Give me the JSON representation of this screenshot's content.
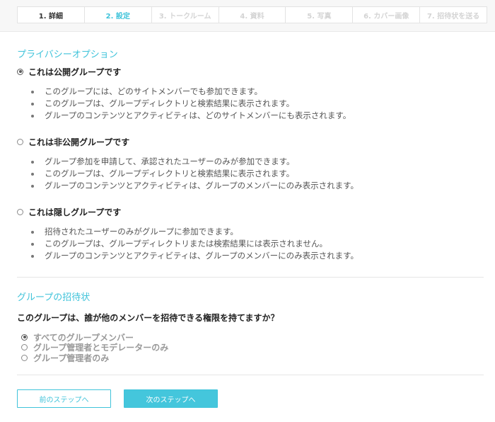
{
  "steps": [
    {
      "label": "1. 詳細",
      "state": "done"
    },
    {
      "label": "2. 設定",
      "state": "active"
    },
    {
      "label": "3. トークルーム",
      "state": "pending"
    },
    {
      "label": "4. 資料",
      "state": "pending"
    },
    {
      "label": "5. 写真",
      "state": "pending"
    },
    {
      "label": "6. カバー画像",
      "state": "pending"
    },
    {
      "label": "7. 招待状を送る",
      "state": "pending"
    }
  ],
  "privacy": {
    "title": "プライバシーオプション",
    "options": [
      {
        "label": "これは公開グループです",
        "checked": true,
        "bullets": [
          "このグループには、どのサイトメンバーでも参加できます。",
          "このグループは、グループディレクトリと検索結果に表示されます。",
          "グループのコンテンツとアクティビティは、どのサイトメンバーにも表示されます。"
        ]
      },
      {
        "label": "これは非公開グループです",
        "checked": false,
        "bullets": [
          "グループ参加を申請して、承認されたユーザーのみが参加できます。",
          "このグループは、グループディレクトリと検索結果に表示されます。",
          "グループのコンテンツとアクティビティは、グループのメンバーにのみ表示されます。"
        ]
      },
      {
        "label": "これは隠しグループです",
        "checked": false,
        "bullets": [
          "招待されたユーザーのみがグループに参加できます。",
          "このグループは、グループディレクトリまたは検索結果には表示されません。",
          "グループのコンテンツとアクティビティは、グループのメンバーにのみ表示されます。"
        ]
      }
    ]
  },
  "invites": {
    "title": "グループの招待状",
    "question": "このグループは、誰が他のメンバーを招待できる権限を持てますか？",
    "options": [
      {
        "label": "すべてのグループメンバー",
        "checked": true
      },
      {
        "label": "グループ管理者とモデレーターのみ",
        "checked": false
      },
      {
        "label": "グループ管理者のみ",
        "checked": false
      }
    ]
  },
  "buttons": {
    "prev_label": "前のステップへ",
    "next_label": "次のステップへ"
  },
  "colors": {
    "accent": "#3fc3da",
    "pending_step": "#d4d4d4"
  }
}
